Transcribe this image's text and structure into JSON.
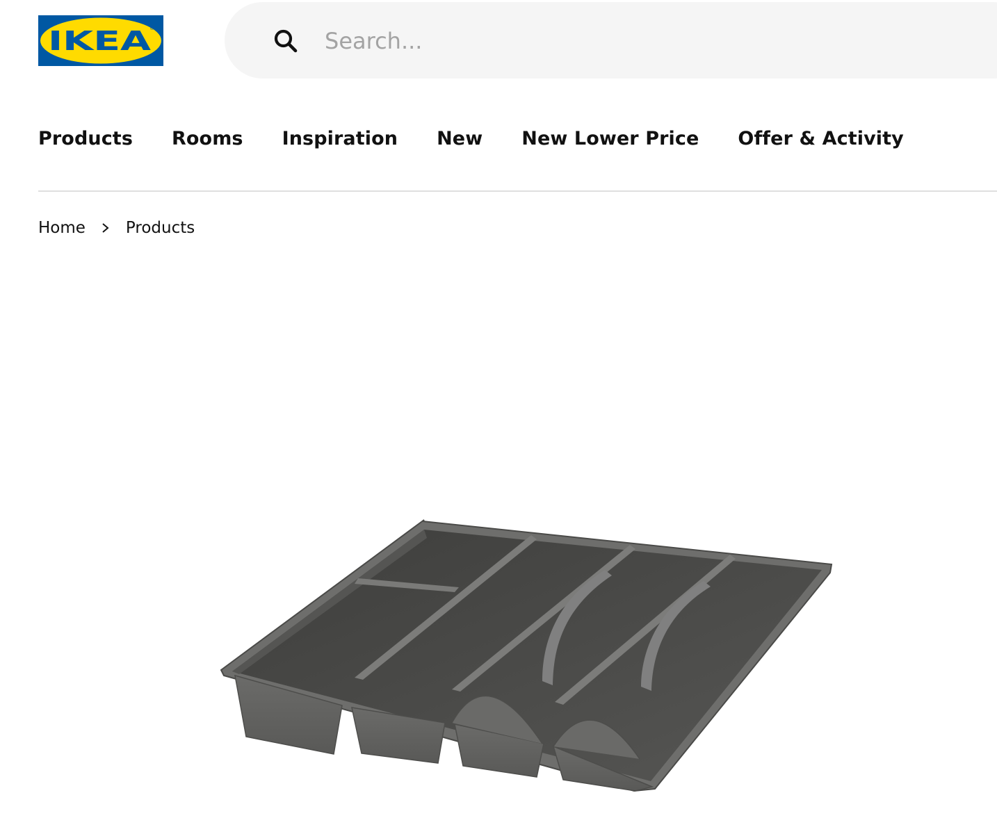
{
  "header": {
    "logo_text": "IKEA",
    "logo_colors": {
      "background": "#0058A3",
      "ellipse": "#FFDB00"
    },
    "search": {
      "placeholder": "Search...",
      "value": ""
    }
  },
  "main_nav": {
    "items": [
      {
        "label": "Products"
      },
      {
        "label": "Rooms"
      },
      {
        "label": "Inspiration"
      },
      {
        "label": "New"
      },
      {
        "label": "New Lower Price"
      },
      {
        "label": "Offer & Activity"
      }
    ]
  },
  "breadcrumb": {
    "items": [
      {
        "label": "Home"
      },
      {
        "label": "Products"
      }
    ]
  },
  "product": {
    "image_icon": "cutlery-tray-image",
    "color": "#5e5e5c"
  }
}
